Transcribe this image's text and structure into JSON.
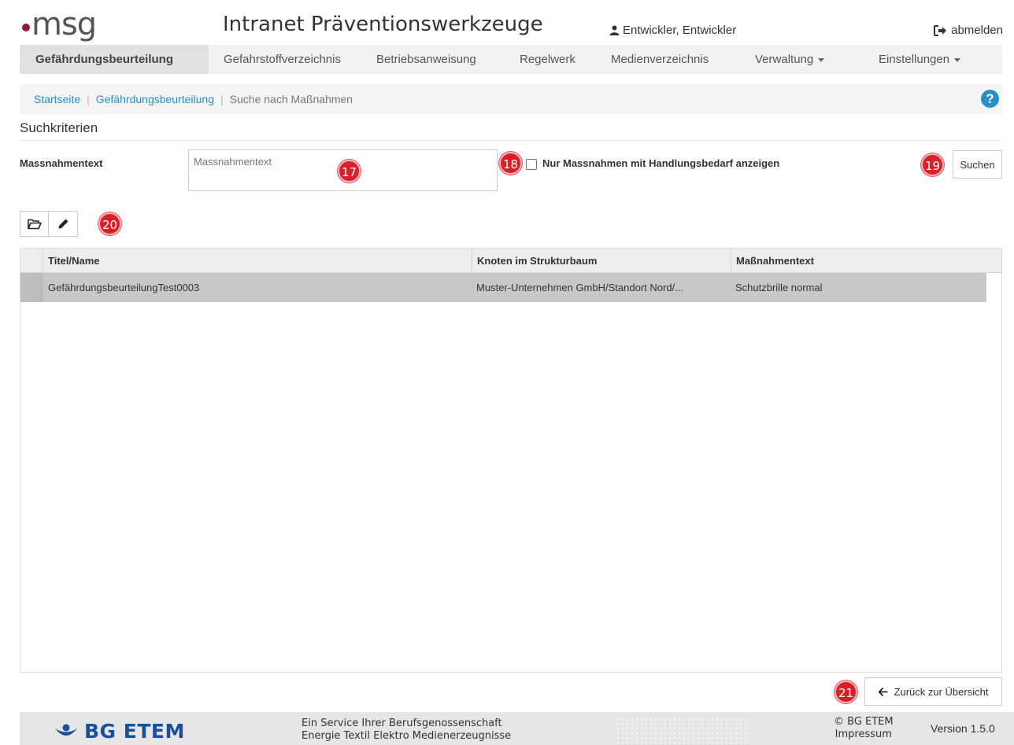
{
  "header": {
    "logo_text": "msg",
    "app_title": "Intranet Präventionswerkzeuge",
    "user_name": "Entwickler, Entwickler",
    "logout_label": "abmelden"
  },
  "nav": {
    "items": [
      {
        "label": "Gefährdungsbeurteilung",
        "active": true
      },
      {
        "label": "Gefahrstoffverzeichnis"
      },
      {
        "label": "Betriebsanweisung"
      },
      {
        "label": "Regelwerk"
      },
      {
        "label": "Medienverzeichnis"
      },
      {
        "label": "Verwaltung",
        "dropdown": true
      },
      {
        "label": "Einstellungen",
        "dropdown": true
      }
    ]
  },
  "breadcrumb": {
    "items": [
      "Startseite",
      "Gefährdungsbeurteilung"
    ],
    "current": "Suche nach Maßnahmen",
    "help_glyph": "?"
  },
  "search": {
    "section_title": "Suchkriterien",
    "field_label": "Massnahmentext",
    "field_placeholder": "Massnahmentext",
    "field_value": "",
    "checkbox_label": "Nur Massnahmen mit Handlungsbedarf anzeigen",
    "checkbox_checked": false,
    "button_label": "Suchen"
  },
  "badges": {
    "b17": "17",
    "b18": "18",
    "b19": "19",
    "b20": "20",
    "b21": "21"
  },
  "toolbar": {
    "icons": [
      "folder-open-icon",
      "pencil-icon"
    ]
  },
  "table": {
    "columns": [
      "Titel/Name",
      "Knoten im Strukturbaum",
      "Maßnahmentext"
    ],
    "rows": [
      [
        "GefährdungsbeurteilungTest0003",
        "Muster-Unternehmen GmbH/Standort Nord/...",
        "Schutzbrille normal"
      ]
    ]
  },
  "back_button": {
    "label": "Zurück zur Übersicht"
  },
  "footer": {
    "org_name": "BG ETEM",
    "service_line1": "Ein Service Ihrer Berufsgenossenschaft",
    "service_line2": "Energie Textil Elektro Medienerzeugnisse",
    "copyright": "© BG ETEM",
    "impressum": "Impressum",
    "version": "Version 1.5.0"
  },
  "colors": {
    "accent_link": "#2a8fc7",
    "badge": "#d8202a",
    "brand_dot": "#8b1a3c",
    "bg_etem_blue": "#1c4f9a"
  }
}
